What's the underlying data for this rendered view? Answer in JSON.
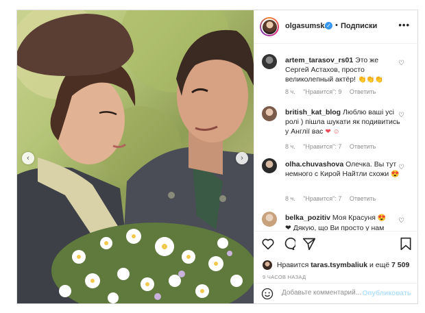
{
  "post": {
    "author": "olgasumska",
    "follow_label": "Подписки",
    "dot": "•",
    "more_label": "•••",
    "colors": {
      "accent": "#3897f0",
      "heart": "#ed4956",
      "muted": "#8e8e8e"
    }
  },
  "comments": [
    {
      "user": "artem_tarasov_rs01",
      "text": "Это же Сергей Астахов, просто великолепный актёр!",
      "emoji": "👏👏👏",
      "time": "8 ч.",
      "likes": "\"Нравится\": 9",
      "reply": "Ответить"
    },
    {
      "user": "british_kat_blog",
      "text": "Люблю ваші усі ролі ) пішла шукати як подивитись у Англії вас",
      "emoji": "❤ ☺",
      "time": "8 ч.",
      "likes": "\"Нравится\": 7",
      "reply": "Ответить"
    },
    {
      "user": "olha.chuvashova",
      "text": "Олечка. Вы тут немного с Кирой Найтли схожи",
      "emoji": "😍",
      "time": "8 ч.",
      "likes": "\"Нравится\": 7",
      "reply": "Ответить"
    },
    {
      "user": "belka_pozitiv",
      "text": "Моя Красуня",
      "emoji": "😍",
      "text2": "❤ Дякую, що Ви просто у нам"
    }
  ],
  "liked": {
    "prefix": "Нравится",
    "user": "taras.tsymbaliuk",
    "suffix": "и ещё",
    "count": "7 509"
  },
  "time_ago": "9 ЧАСОВ НАЗАД",
  "comment_input": {
    "placeholder": "Добавьте комментарий...",
    "publish_label": "Опубликовать"
  },
  "nav": {
    "prev": "‹",
    "next": "›"
  }
}
